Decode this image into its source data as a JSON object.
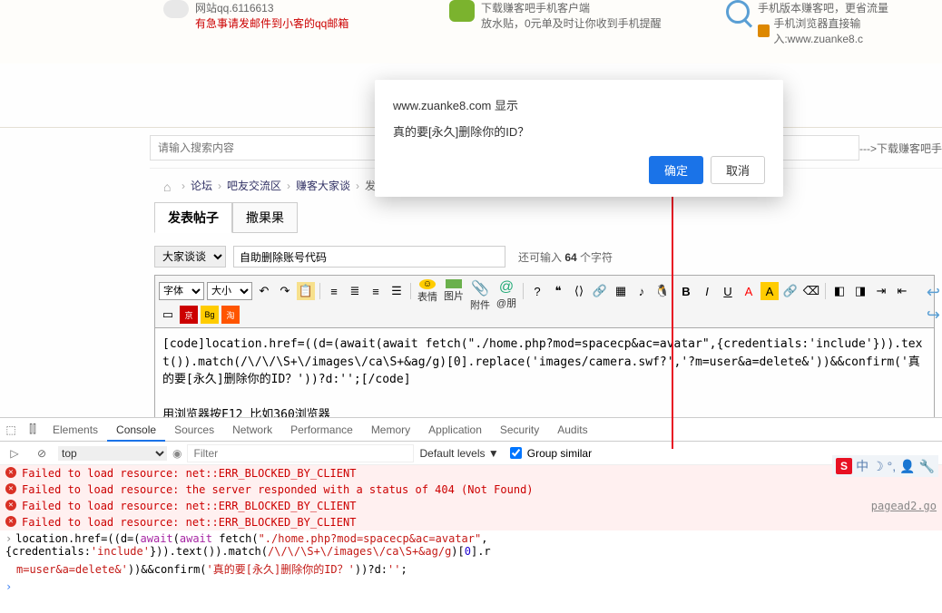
{
  "top": {
    "qq_line1": "网站qq.6116613",
    "qq_line2": "有急事请发邮件到小客的qq邮箱",
    "wechat_line1": "下载赚客吧手机客户端",
    "wechat_line2": "放水贴，0元单及时让你收到手机提醒",
    "mobile_line1": "手机版本赚客吧，更省流量",
    "mobile_line2": "手机浏览器直接输入:www.zuanke8.c"
  },
  "search": {
    "placeholder": "请输入搜索内容",
    "download": "--->下载赚客吧手"
  },
  "breadcrumb": {
    "items": [
      "论坛",
      "吧友交流区",
      "赚客大家谈",
      "发表"
    ]
  },
  "tabs": {
    "post": "发表帖子",
    "reward": "撒果果"
  },
  "form": {
    "category": "大家谈谈",
    "title": "自助删除账号代码",
    "chars_prefix": "还可输入 ",
    "chars_num": "64",
    "chars_suffix": " 个字符"
  },
  "toolbar": {
    "font": "字体",
    "size": "大小",
    "labels": {
      "emoji": "表情",
      "img": "图片",
      "attach": "附件",
      "at": "@朋"
    }
  },
  "editor": {
    "content": "[code]location.href=((d=(await(await fetch(\"./home.php?mod=spacecp&ac=avatar\",{credentials:'include'})).text()).match(/\\/\\/\\S+\\/images\\/ca\\S+&ag/g)[0].replace('images/camera.swf?','?m=user&a=delete&'))&&confirm('真的要[永久]删除你的ID？'))?d:'';[/code]",
    "note": "用浏览器按F12  比如360浏览器"
  },
  "dialog": {
    "title": "www.zuanke8.com 显示",
    "message": "真的要[永久]删除你的ID？",
    "ok": "确定",
    "cancel": "取消"
  },
  "devtools": {
    "tabs": [
      "Elements",
      "Console",
      "Sources",
      "Network",
      "Performance",
      "Memory",
      "Application",
      "Security",
      "Audits"
    ],
    "active_tab": "Console",
    "context": "top",
    "filter": "Filter",
    "levels": "Default levels ▼",
    "group": "Group similar",
    "errors": [
      "Failed to load resource: net::ERR_BLOCKED_BY_CLIENT",
      "Failed to load resource: the server responded with a status of 404 (Not Found)",
      "Failed to load resource: net::ERR_BLOCKED_BY_CLIENT",
      "Failed to load resource: net::ERR_BLOCKED_BY_CLIENT"
    ],
    "err_link": "pagead2.go",
    "cmd": {
      "p1": "location.href=((d=(",
      "kw1": "await",
      "p2": "(",
      "kw2": "await",
      "p3": " fetch(",
      "s1": "\"./home.php?mod=spacecp&ac=avatar\"",
      "p4": ",{credentials:",
      "s2": "'include'",
      "p5": "})).text()).match(",
      "re": "/\\/\\/\\S+\\/images\\/ca\\S+&ag/g",
      "p6": ")[",
      "n0": "0",
      "p7": "].r",
      "line2a": "m=user&a=delete&'",
      "p8": "))&&confirm(",
      "s3": "'真的要[永久]删除你的ID？'",
      "p9": "))?d:",
      "s4": "''",
      "p10": ";"
    }
  },
  "ext": {
    "zh": "中"
  }
}
